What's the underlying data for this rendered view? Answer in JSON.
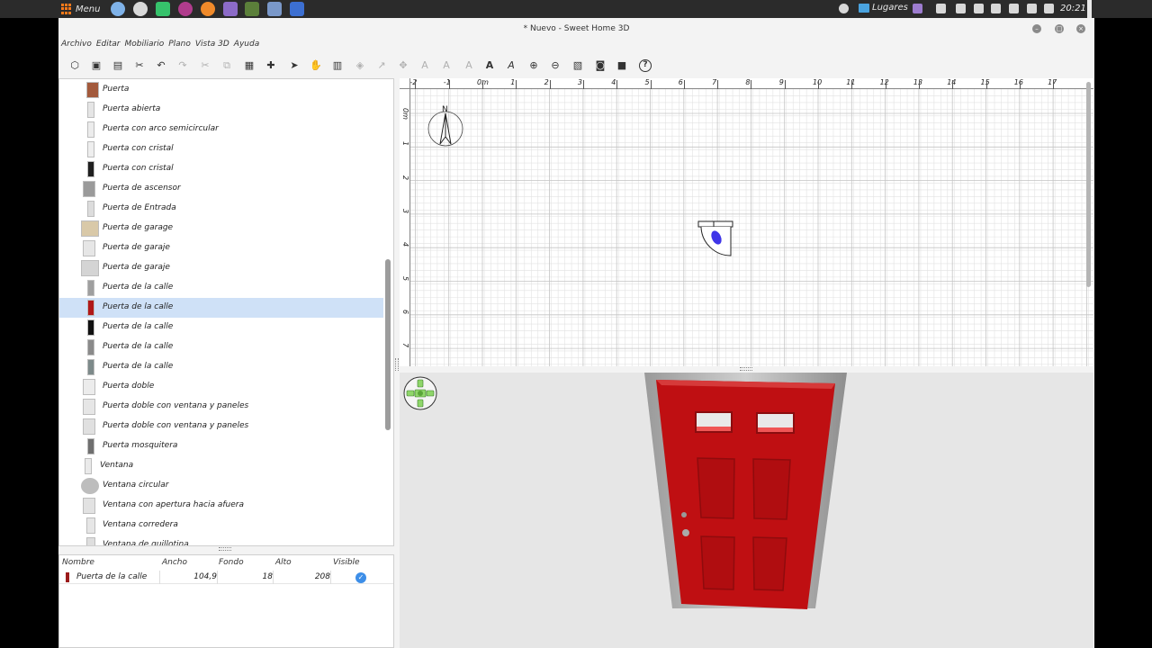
{
  "system_panel": {
    "menu_label": "Menu",
    "places_label": "Lugares",
    "clock": "20:21"
  },
  "window": {
    "title": "* Nuevo - Sweet Home 3D"
  },
  "menubar": [
    "Archivo",
    "Editar",
    "Mobiliario",
    "Plano",
    "Vista 3D",
    "Ayuda"
  ],
  "catalog": {
    "items": [
      {
        "label": "Puerta",
        "thumb_color": "#a35a3c"
      },
      {
        "label": "Puerta abierta",
        "thumb_color": "#e5e5e5"
      },
      {
        "label": "Puerta con arco semicircular",
        "thumb_color": "#ececec"
      },
      {
        "label": "Puerta con cristal",
        "thumb_color": "#eeeeee"
      },
      {
        "label": "Puerta con cristal",
        "thumb_color": "#1f1f1f"
      },
      {
        "label": "Puerta de ascensor",
        "thumb_color": "#9a9a9a"
      },
      {
        "label": "Puerta de Entrada",
        "thumb_color": "#dcdcdc"
      },
      {
        "label": "Puerta de garage",
        "thumb_color": "#d9c9a8"
      },
      {
        "label": "Puerta de garaje",
        "thumb_color": "#e6e6e6"
      },
      {
        "label": "Puerta de garaje",
        "thumb_color": "#d4d4d4"
      },
      {
        "label": "Puerta de la calle",
        "thumb_color": "#9f9f9f"
      },
      {
        "label": "Puerta de la calle",
        "thumb_color": "#b01818"
      },
      {
        "label": "Puerta de la calle",
        "thumb_color": "#111111"
      },
      {
        "label": "Puerta de la calle",
        "thumb_color": "#8a8a8a"
      },
      {
        "label": "Puerta de la calle",
        "thumb_color": "#7d8a8a"
      },
      {
        "label": "Puerta doble",
        "thumb_color": "#ececec"
      },
      {
        "label": "Puerta doble con ventana y paneles",
        "thumb_color": "#e6e6e6"
      },
      {
        "label": "Puerta doble con ventana y paneles",
        "thumb_color": "#e0e0e0"
      },
      {
        "label": "Puerta mosquitera",
        "thumb_color": "#6f6f6f"
      },
      {
        "label": "Ventana",
        "thumb_color": "#eaeaea"
      },
      {
        "label": "Ventana circular",
        "thumb_color": "#bdbdbd"
      },
      {
        "label": "Ventana con apertura hacia afuera",
        "thumb_color": "#e2e2e2"
      },
      {
        "label": "Ventana corredera",
        "thumb_color": "#e6e6e6"
      },
      {
        "label": "Ventana de guillotina",
        "thumb_color": "#dedede"
      }
    ],
    "selected_index": 11
  },
  "furniture_table": {
    "columns": [
      "Nombre",
      "Ancho",
      "Fondo",
      "Alto",
      "Visible"
    ],
    "rows": [
      {
        "name": "Puerta de la calle",
        "width": "104,9",
        "depth": "18",
        "height": "208",
        "visible": true,
        "color": "#9b1b1b"
      }
    ]
  },
  "plan": {
    "ruler_h": [
      "-2",
      "-1",
      "0m",
      "1",
      "2",
      "3",
      "4",
      "5",
      "6",
      "7",
      "8",
      "9",
      "10",
      "11",
      "12",
      "13",
      "14",
      "15",
      "16",
      "17"
    ],
    "ruler_v": [
      "0m",
      "1",
      "2",
      "3",
      "4",
      "5",
      "6",
      "7"
    ],
    "compass_label": "N"
  },
  "view3d": {
    "door_color": "#c40f12"
  }
}
